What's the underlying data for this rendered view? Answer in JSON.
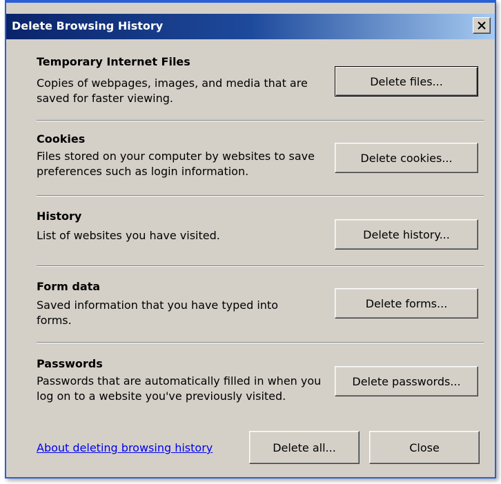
{
  "window": {
    "title": "Delete Browsing History",
    "close_glyph": "✕"
  },
  "sections": [
    {
      "title": "Temporary Internet Files",
      "description": "Copies of webpages, images, and media that are saved for faster viewing.",
      "button": "Delete files..."
    },
    {
      "title": "Cookies",
      "description": "Files stored on your computer by websites to save preferences such as login information.",
      "button": "Delete cookies..."
    },
    {
      "title": "History",
      "description": "List of websites you have visited.",
      "button": "Delete history..."
    },
    {
      "title": "Form data",
      "description": "Saved information that you have typed into forms.",
      "button": "Delete forms..."
    },
    {
      "title": "Passwords",
      "description": "Passwords that are automatically filled in when you log on to a website you've previously visited.",
      "button": "Delete passwords..."
    }
  ],
  "footer": {
    "about_link": "About deleting browsing history",
    "delete_all": "Delete all...",
    "close": "Close"
  },
  "colors": {
    "dialog_bg": "#d4d0c8",
    "titlebar": "#0a246a",
    "link": "#0000ee"
  }
}
